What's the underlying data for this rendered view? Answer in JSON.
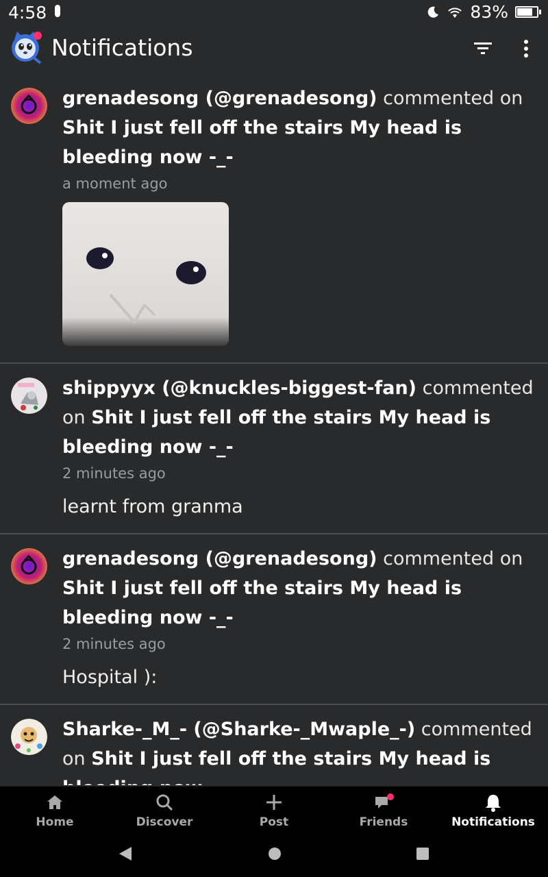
{
  "status_bar": {
    "time": "4:58",
    "battery_pct": "83%",
    "battery_level": 0.83
  },
  "app_bar": {
    "title": "Notifications",
    "logo_icon": "tumblr-mascot-icon",
    "filter_icon": "filter-icon",
    "more_icon": "more-vert-icon"
  },
  "notifications": [
    {
      "user": "grenadesong (@grenadesong)",
      "action": "commented on",
      "post": "Shit I just fell off the stairs My head is bleeding now -_-",
      "time": "a moment ago",
      "has_image": true
    },
    {
      "user": "shippyyx (@knuckles-biggest-fan)",
      "action": "commented on",
      "post": "Shit I just fell off the stairs My head is bleeding now -_-",
      "time": "2 minutes ago",
      "comment": "learnt from granma"
    },
    {
      "user": "grenadesong (@grenadesong)",
      "action": "commented on",
      "post": "Shit I just fell off the stairs My head is bleeding now -_-",
      "time": "2 minutes ago",
      "comment": "Hospital ):"
    },
    {
      "user": "Sharke-_M_- (@Sharke-_Mwaple_-)",
      "action": "commented on",
      "post": "Shit I just fell off the stairs My head is bleeding now -_-"
    }
  ],
  "bottom_nav": {
    "items": [
      {
        "label": "Home",
        "icon": "home-icon"
      },
      {
        "label": "Discover",
        "icon": "search-icon"
      },
      {
        "label": "Post",
        "icon": "plus-icon"
      },
      {
        "label": "Friends",
        "icon": "chat-icon"
      },
      {
        "label": "Notifications",
        "icon": "bell-icon"
      }
    ],
    "active": "Notifications"
  },
  "colors": {
    "background": "#282a2b",
    "divider": "#4a4d4f",
    "nav_background": "#000000",
    "badge": "#ff2f6e"
  }
}
